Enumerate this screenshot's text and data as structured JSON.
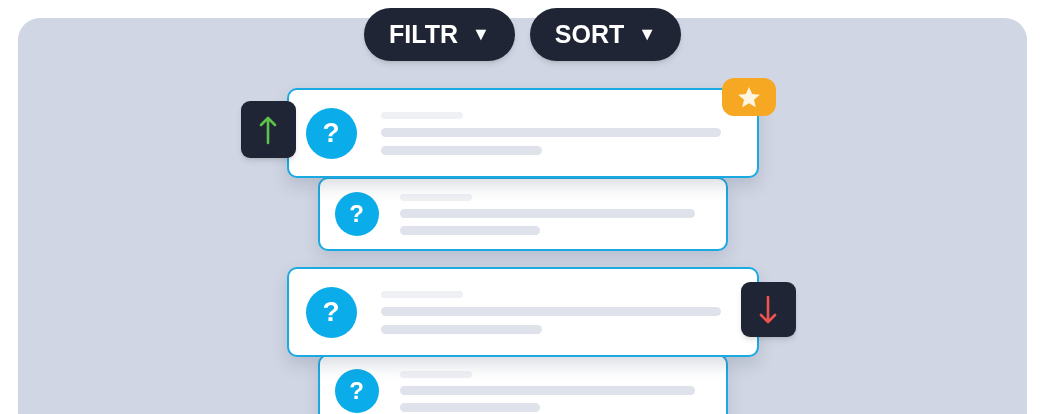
{
  "toolbar": [
    {
      "label": "FILTR",
      "caret": "▼"
    },
    {
      "label": "SORT",
      "caret": "▼"
    }
  ],
  "cards": [
    {
      "kind": "main",
      "glyph": "?",
      "move_up": true,
      "move_down": false,
      "starred": true
    },
    {
      "kind": "sub",
      "glyph": "?",
      "move_up": false,
      "move_down": false,
      "starred": false
    },
    {
      "kind": "main",
      "glyph": "?",
      "move_up": false,
      "move_down": true,
      "starred": false
    },
    {
      "kind": "sub",
      "glyph": "?",
      "move_up": false,
      "move_down": false,
      "starred": false
    }
  ]
}
